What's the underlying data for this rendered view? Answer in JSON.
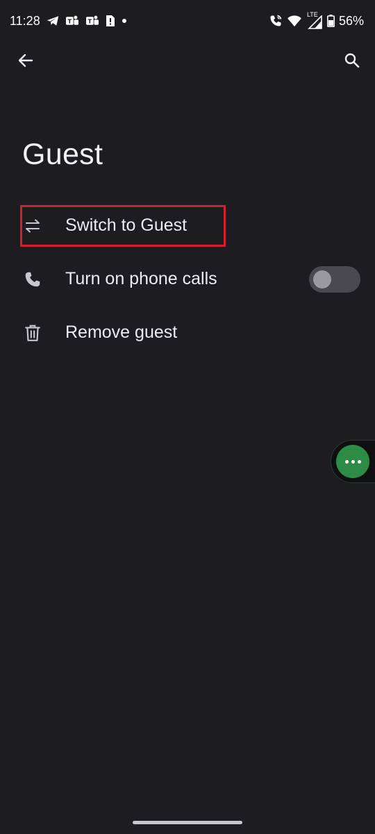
{
  "status_bar": {
    "time": "11:28",
    "notification_icons": [
      "telegram-icon",
      "teams-icon",
      "teams-icon",
      "sim-alert-icon",
      "dot-icon"
    ],
    "network_label": "LTE",
    "battery_percent": "56%"
  },
  "app_bar": {
    "back_icon": "arrow-left-icon",
    "search_icon": "search-icon"
  },
  "page": {
    "title": "Guest"
  },
  "list": {
    "items": [
      {
        "icon": "swap-arrows-icon",
        "label": "Switch to Guest",
        "highlighted": true
      },
      {
        "icon": "phone-icon",
        "label": "Turn on phone calls",
        "toggle": false
      },
      {
        "icon": "trash-icon",
        "label": "Remove guest"
      }
    ]
  },
  "colors": {
    "background": "#1d1c21",
    "highlight_border": "#d3202b",
    "fab_green": "#2e8b46"
  }
}
